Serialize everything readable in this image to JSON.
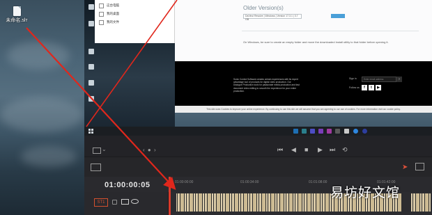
{
  "desktop": {
    "icon_label": "未命名.slт",
    "side_icons": [
      "",
      "",
      "",
      "",
      ""
    ]
  },
  "explorer": {
    "items": [
      "这台电脑",
      "我的桌面",
      "我的文件"
    ]
  },
  "browser": {
    "older_title": "Older Version(s)",
    "select_text": "DaVinci Resolve | Windows | Version 17.3.1 | 3.7 GB",
    "note": "On Windows, be sure to create an empty folder and move the downloaded install utility to that folder before opening it.",
    "footer_text": "Sonic Control Software creates certain experiences with its expert advantage tool of products for digital video production. Our Dialogue Production tools for passionate media production and fast document video editing to smooth the experience for your entire production.",
    "signin_label": "Sign in",
    "email_placeholder": "Enter email address",
    "go_label": "›",
    "follow_label": "Follow us",
    "social": [
      "f",
      "t",
      "▶"
    ],
    "cookie_text": "This site uses Cookies to improve your online experience. By continuing to use this site we will assume that you are agreeing to our use of cookies. For more information visit our cookie policy."
  },
  "editor": {
    "timecode": "01:00:00:05",
    "ruler": [
      "01:00:00:00",
      "01:00:34:00",
      "01:01:08:00",
      "01:01:42:00"
    ],
    "track_name": "ST1",
    "transport": [
      "⏮",
      "◀",
      "■",
      "▶",
      "⏭",
      "⟲"
    ]
  },
  "watermark": "易坊好文馆",
  "colors": {
    "arrow": "#e0271c",
    "playhead": "#d93a2b",
    "clip": "#d9c9a6"
  }
}
